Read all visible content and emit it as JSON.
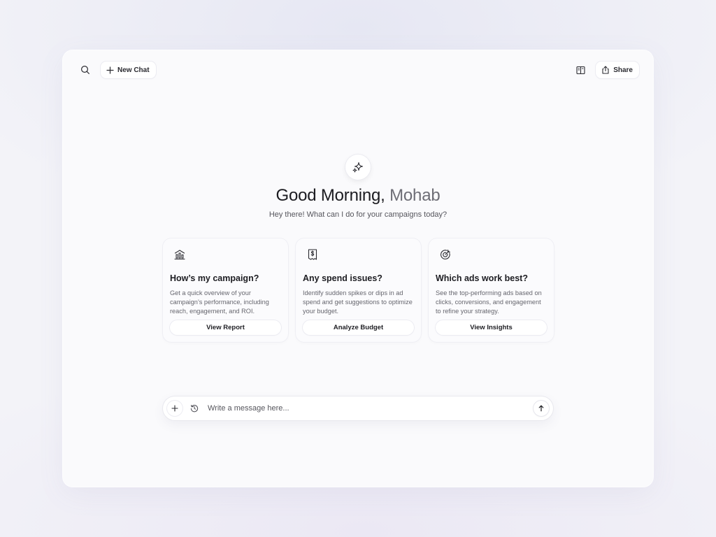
{
  "topbar": {
    "search_icon": "search-icon",
    "new_chat_label": "New Chat",
    "layout_icon": "sidebar-layout-icon",
    "share_label": "Share"
  },
  "hero": {
    "icon": "sparkle-icon",
    "greeting": "Good Morning,",
    "user_name": "Mohab",
    "subtitle": "Hey there! What can I do for your campaigns today?"
  },
  "cards": [
    {
      "icon": "campaign-chart-icon",
      "title": "How’s my campaign?",
      "description": "Get a quick overview of your campaign’s performance, including reach, engagement, and ROI.",
      "button": "View Report"
    },
    {
      "icon": "receipt-dollar-icon",
      "title": "Any spend issues?",
      "description": "Identify sudden spikes or dips in ad spend and get suggestions to optimize your budget.",
      "button": "Analyze Budget"
    },
    {
      "icon": "target-icon",
      "title": "Which ads work best?",
      "description": "See the top-performing ads based on clicks, conversions, and engagement to refine your strategy.",
      "button": "View Insights"
    }
  ],
  "composer": {
    "placeholder": "Write a message here...",
    "value": ""
  },
  "colors": {
    "background": "#f3f3f8",
    "window": "#fafafc",
    "text_primary": "#1d1d22",
    "text_muted": "#6e6e76"
  }
}
